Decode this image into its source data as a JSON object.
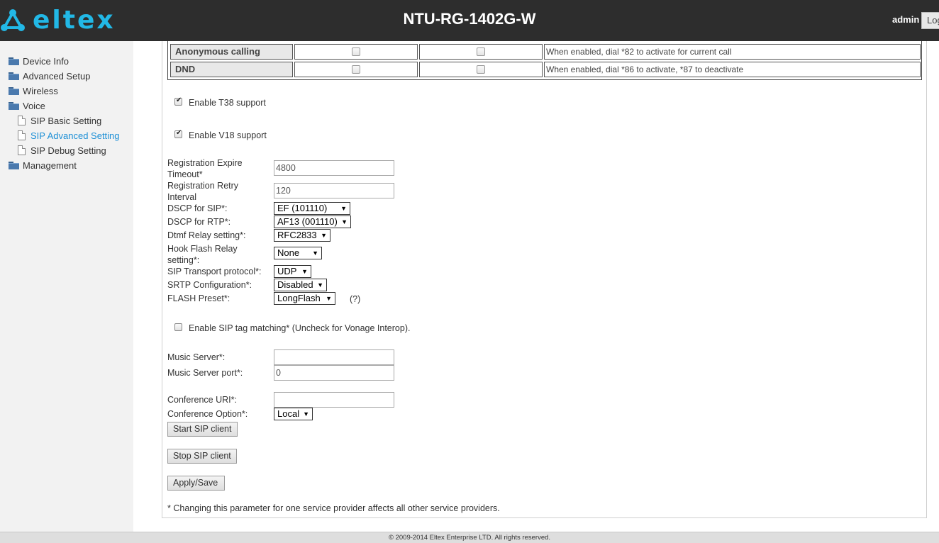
{
  "header": {
    "logo_text": "eltex",
    "device_title": "NTU-RG-1402G-W",
    "user": "admin",
    "logout_label": "Log"
  },
  "sidebar": {
    "items": [
      {
        "label": "Device Info",
        "icon": "folder-icon"
      },
      {
        "label": "Advanced Setup",
        "icon": "folder-icon"
      },
      {
        "label": "Wireless",
        "icon": "folder-icon"
      },
      {
        "label": "Voice",
        "icon": "folder-icon"
      },
      {
        "label": "SIP Basic Setting",
        "icon": "page-icon"
      },
      {
        "label": "SIP Advanced Setting",
        "icon": "page-icon",
        "active": true
      },
      {
        "label": "SIP Debug Setting",
        "icon": "page-icon"
      },
      {
        "label": "Management",
        "icon": "folder-icon"
      }
    ]
  },
  "features": [
    {
      "name": "Anonymous calling",
      "enabled1": false,
      "enabled2": false,
      "description": "When enabled, dial *82 to activate for current call"
    },
    {
      "name": "DND",
      "enabled1": false,
      "enabled2": false,
      "description": "When enabled, dial *86 to activate, *87 to deactivate"
    }
  ],
  "options": {
    "t38": {
      "label": "Enable T38 support",
      "checked": true
    },
    "v18": {
      "label": "Enable V18 support",
      "checked": true
    },
    "sip_tag": {
      "label": "Enable SIP tag matching* (Uncheck for Vonage Interop).",
      "checked": false
    }
  },
  "form": {
    "reg_expire": {
      "label": "Registration Expire Timeout*",
      "value": "4800"
    },
    "reg_retry": {
      "label": "Registration Retry Interval",
      "value": "120"
    },
    "dscp_sip": {
      "label": "DSCP for SIP*:",
      "value": "EF (101110)"
    },
    "dscp_rtp": {
      "label": "DSCP for RTP*:",
      "value": "AF13 (001110)"
    },
    "dtmf": {
      "label": "Dtmf Relay setting*:",
      "value": "RFC2833"
    },
    "hook_flash": {
      "label": "Hook Flash Relay setting*:",
      "value": "None"
    },
    "transport": {
      "label": "SIP Transport protocol*:",
      "value": "UDP"
    },
    "srtp": {
      "label": "SRTP Configuration*:",
      "value": "Disabled"
    },
    "flash_preset": {
      "label": "FLASH Preset*:",
      "value": "LongFlash",
      "help": "(?)"
    },
    "music_server": {
      "label": "Music Server*:",
      "value": ""
    },
    "music_port": {
      "label": "Music Server port*:",
      "value": "0"
    },
    "conf_uri": {
      "label": "Conference URI*:",
      "value": ""
    },
    "conf_option": {
      "label": "Conference Option*:",
      "value": "Local"
    }
  },
  "buttons": {
    "start": "Start SIP client",
    "stop": "Stop SIP client",
    "apply": "Apply/Save"
  },
  "note": "* Changing this parameter for one service provider affects all other service providers.",
  "footer": "© 2009-2014 Eltex Enterprise LTD. All rights reserved.",
  "colors": {
    "header_bg": "#2d2d2d",
    "brand": "#22b8e6",
    "active_link": "#1e90d6"
  }
}
